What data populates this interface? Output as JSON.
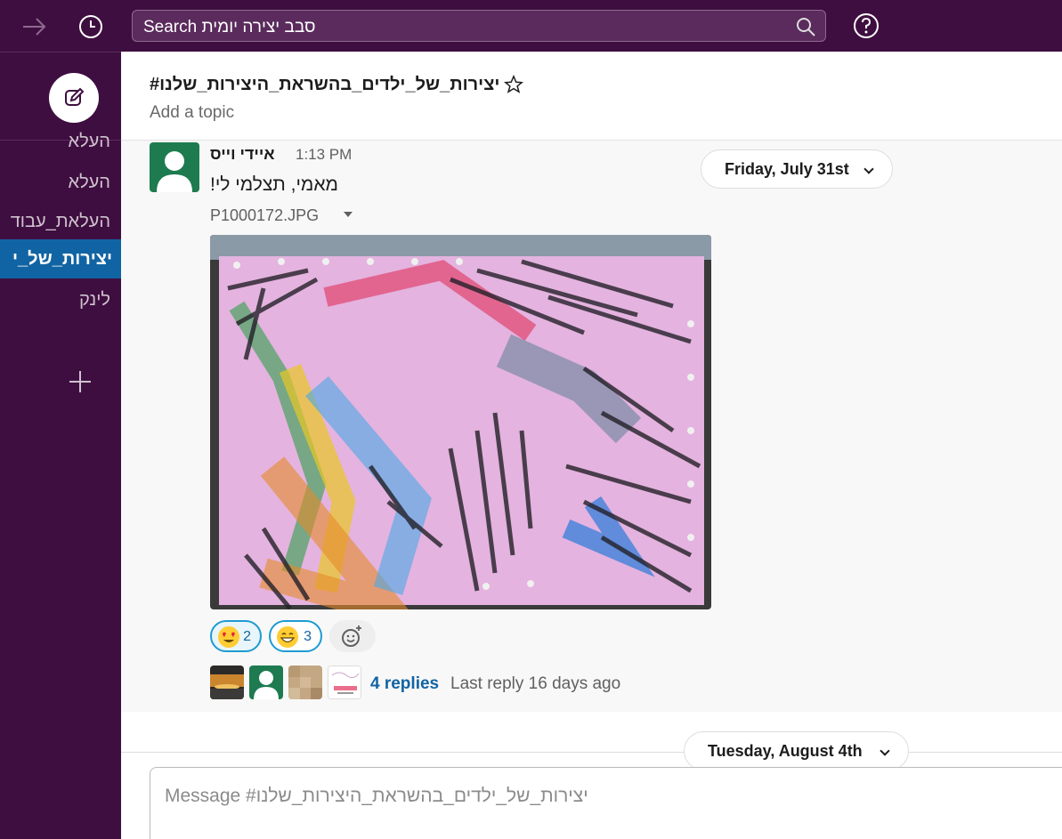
{
  "topbar": {
    "search_text": "Search סבב יצירה יומית",
    "icons": [
      "forward-arrow-icon",
      "history-clock-icon",
      "search-icon",
      "help-icon"
    ]
  },
  "sidebar": {
    "channels": [
      {
        "label": "העלא"
      },
      {
        "label": "העלא"
      },
      {
        "label": "העלאת_עבוד"
      },
      {
        "label": "יצירות_של_י",
        "active": true
      },
      {
        "label": "לינק"
      }
    ]
  },
  "header": {
    "channel_name": "יצירות_של_ילדים_בהשראת_היצירות_שלנו#",
    "topic": "Add a topic"
  },
  "message": {
    "author": "איידי וייס",
    "time": "1:13 PM",
    "text": "מאמי, תצלמי לי!",
    "file_name": "P1000172.JPG",
    "reactions": [
      {
        "emoji": "heart-eyes",
        "count": "2"
      },
      {
        "emoji": "grin",
        "count": "3"
      }
    ],
    "replies_label": "4 replies",
    "last_reply": "Last reply 16 days ago"
  },
  "dates": {
    "first": "Friday, July 31st",
    "second": "Tuesday, August 4th"
  },
  "composer": {
    "placeholder": "Message #יצירות_של_ילדים_בהשראת_היצירות_שלנו"
  },
  "colors": {
    "sidebar_bg": "#3f0e40",
    "active_channel": "#1164a3",
    "link": "#1264a3",
    "reaction_border": "#1d9bd1"
  }
}
